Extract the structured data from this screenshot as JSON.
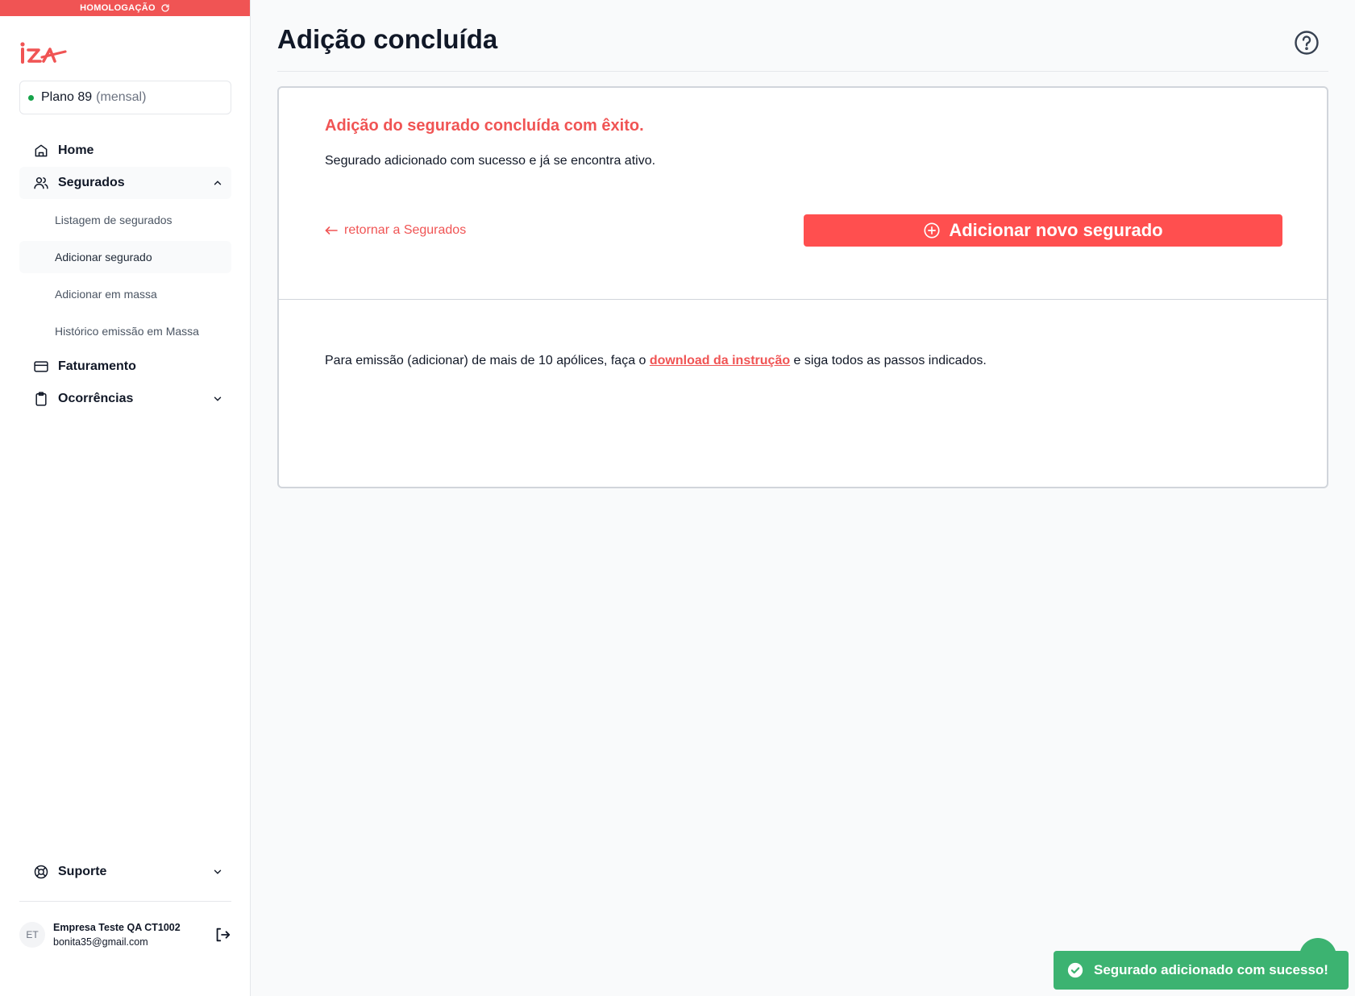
{
  "env_banner": {
    "label": "HOMOLOGAÇÃO"
  },
  "plan": {
    "name": "Plano 89",
    "period": "(mensal)"
  },
  "nav": {
    "home": "Home",
    "segurados": "Segurados",
    "sub_items": [
      "Listagem de segurados",
      "Adicionar segurado",
      "Adicionar em massa",
      "Histórico emissão em Massa"
    ],
    "faturamento": "Faturamento",
    "ocorrencias": "Ocorrências",
    "suporte": "Suporte"
  },
  "user": {
    "initials": "ET",
    "name": "Empresa Teste QA CT1002",
    "email": "bonita35@gmail.com"
  },
  "page": {
    "title": "Adição concluída"
  },
  "card": {
    "success_title": "Adição do segurado concluída com êxito.",
    "success_text": "Segurado adicionado com sucesso e já se encontra ativo.",
    "back_link": "retornar a Segurados",
    "add_button": "Adicionar novo segurado",
    "info_before": "Para emissão (adicionar) de mais de 10 apólices, faça o ",
    "info_link": "download da instrução",
    "info_after": " e siga todos as passos indicados."
  },
  "toast": {
    "message": "Segurado adicionado com sucesso!"
  },
  "colors": {
    "brand": "#f05454",
    "success": "#3cb371",
    "active_dot": "#16a34a"
  }
}
